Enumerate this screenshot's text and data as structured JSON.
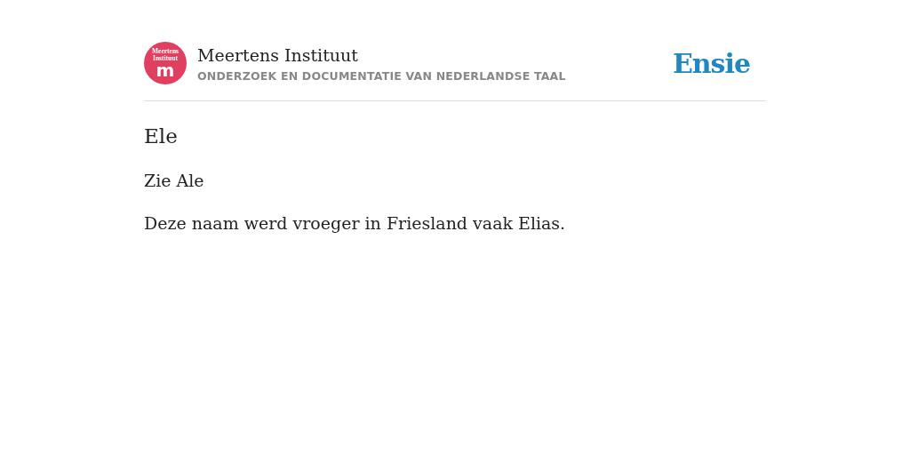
{
  "header": {
    "logo": {
      "lines": [
        "Meertens",
        "Instituut"
      ],
      "letter": "m"
    },
    "title": "Meertens Instituut",
    "subtitle": "ONDERZOEK EN DOCUMENTATIE VAN NEDERLANDSE TAAL",
    "brand": "Ensie"
  },
  "entry": {
    "title": "Ele",
    "paragraphs": [
      "Zie Ale",
      "Deze naam werd vroeger in Friesland vaak Elias."
    ]
  }
}
